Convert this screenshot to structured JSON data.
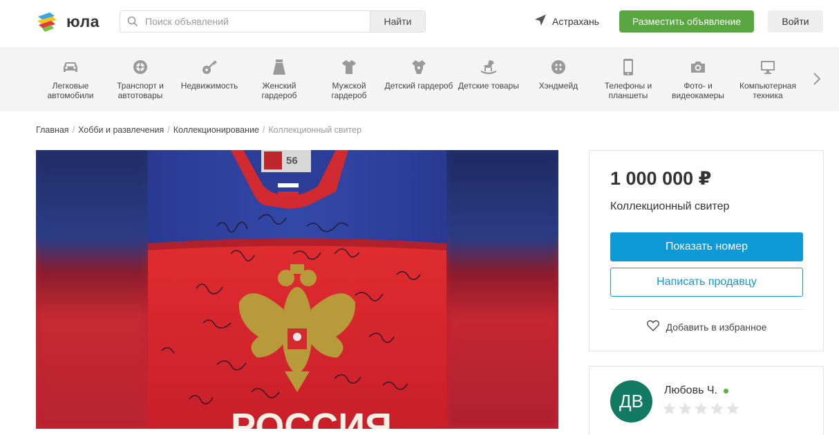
{
  "header": {
    "logo_text": "юла",
    "search_placeholder": "Поиск объявлений",
    "search_button": "Найти",
    "location": "Астрахань",
    "post_button": "Разместить объявление",
    "login_button": "Войти"
  },
  "categories": [
    {
      "label": "Легковые автомобили",
      "icon": "car-icon"
    },
    {
      "label": "Транспорт и автотовары",
      "icon": "wheel-icon"
    },
    {
      "label": "Недвижимость",
      "icon": "key-icon"
    },
    {
      "label": "Женский гардероб",
      "icon": "skirt-icon"
    },
    {
      "label": "Мужской гардероб",
      "icon": "shirt-icon"
    },
    {
      "label": "Детский гардероб",
      "icon": "baby-clothes-icon"
    },
    {
      "label": "Детские товары",
      "icon": "rocking-horse-icon"
    },
    {
      "label": "Хэндмейд",
      "icon": "button-icon"
    },
    {
      "label": "Телефоны и планшеты",
      "icon": "phone-icon"
    },
    {
      "label": "Фото- и видеокамеры",
      "icon": "camera-icon"
    },
    {
      "label": "Компьютерная техника",
      "icon": "monitor-icon"
    }
  ],
  "breadcrumbs": [
    "Главная",
    "Хобби и развлечения",
    "Коллекционирование",
    "Коллекционный свитер"
  ],
  "listing": {
    "price": "1 000 000 ₽",
    "title": "Коллекционный свитер",
    "show_phone_button": "Показать номер",
    "write_button": "Написать продавцу",
    "favorite_label": "Добавить в избранное"
  },
  "photo": {
    "jersey_number": "56",
    "jersey_text": "РОССИЯ"
  },
  "seller": {
    "initials": "ДВ",
    "name": "Любовь Ч.",
    "rating_stars": 0,
    "rating_max": 5
  },
  "colors": {
    "brand_green": "#59a740",
    "accent_blue": "#0e9ad7",
    "avatar": "#127a62"
  }
}
